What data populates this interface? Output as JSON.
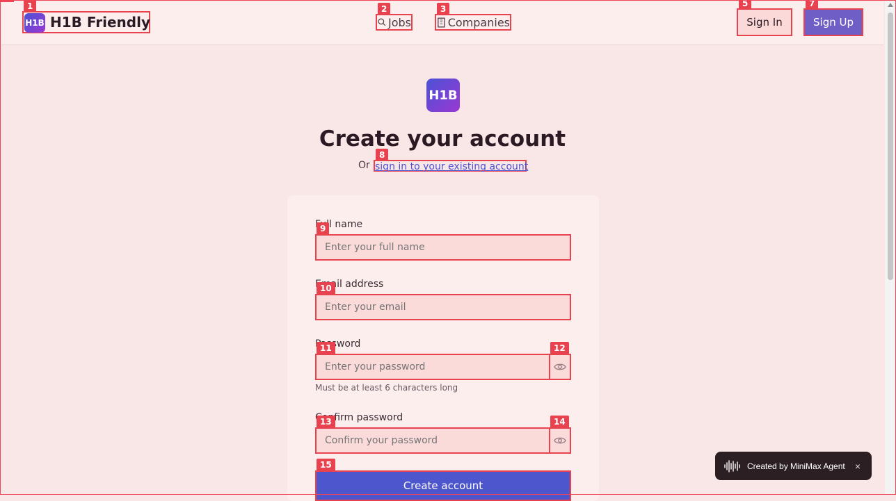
{
  "header": {
    "logo_text": "H1B",
    "brand_name": "H1B Friendly",
    "nav": {
      "jobs": "Jobs",
      "companies": "Companies"
    },
    "sign_in": "Sign In",
    "sign_up": "Sign Up"
  },
  "main": {
    "logo_text": "H1B",
    "title": "Create your account",
    "subtitle_prefix": "Or",
    "signin_link": "sign in to your existing account"
  },
  "form": {
    "full_name": {
      "label": "Full name",
      "placeholder": "Enter your full name"
    },
    "email": {
      "label": "Email address",
      "placeholder": "Enter your email"
    },
    "password": {
      "label": "Password",
      "placeholder": "Enter your password",
      "hint": "Must be at least 6 characters long"
    },
    "confirm_password": {
      "label": "Confirm password",
      "placeholder": "Confirm your password"
    },
    "submit": "Create account"
  },
  "toast": {
    "text": "Created by MiniMax Agent",
    "close": "×"
  },
  "annotations": {
    "tags": [
      "1",
      "2",
      "3",
      "5",
      "7",
      "8",
      "9",
      "10",
      "11",
      "12",
      "13",
      "14",
      "15"
    ]
  },
  "colors": {
    "accent": "#4d56cc",
    "highlight": "#e8424f",
    "page_bg": "#f9e6e6"
  }
}
